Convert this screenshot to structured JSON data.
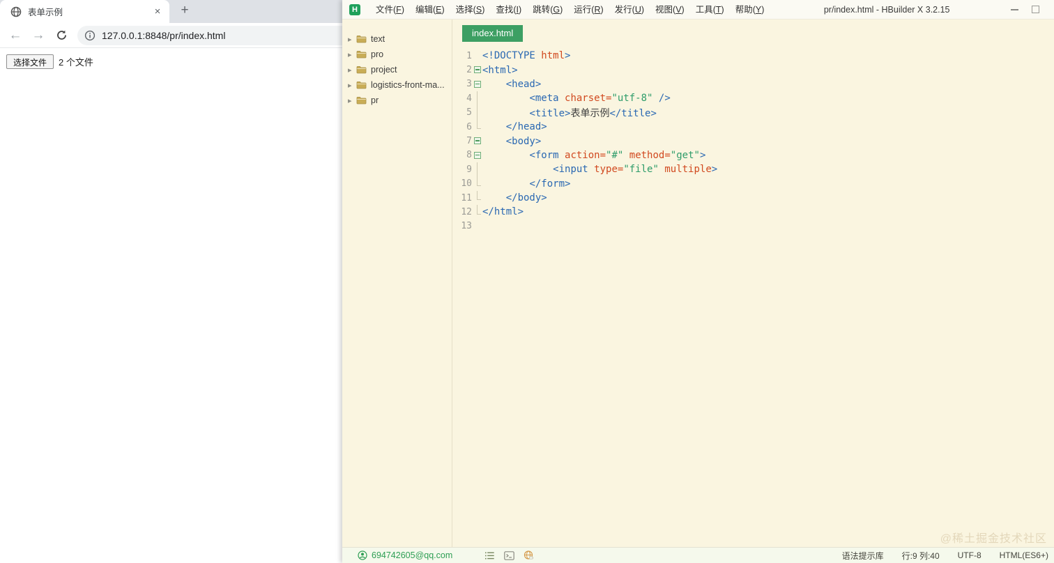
{
  "browser": {
    "tab": {
      "title": "表单示例",
      "close": "×"
    },
    "new_tab": "+",
    "toolbar": {
      "back": "←",
      "forward": "→",
      "url": "127.0.0.1:8848/pr/index.html"
    },
    "page": {
      "file_button": "选择文件",
      "file_status": "2 个文件"
    }
  },
  "hbuilder": {
    "titlebar": {
      "title": "pr/index.html - HBuilder X 3.2.15",
      "logo": "H"
    },
    "menu": {
      "items": [
        "文件(F)",
        "编辑(E)",
        "选择(S)",
        "查找(I)",
        "跳转(G)",
        "运行(R)",
        "发行(U)",
        "视图(V)",
        "工具(T)",
        "帮助(Y)"
      ]
    },
    "sidebar": {
      "folders": [
        "text",
        "pro",
        "project",
        "logistics-front-ma...",
        "pr"
      ]
    },
    "editor": {
      "tab": "index.html",
      "watermark": "@稀土掘金技术社区",
      "lines": [
        {
          "num": 1,
          "fold": "none",
          "segs": [
            [
              "tag",
              "<!DOCTYPE "
            ],
            [
              "attr",
              "html"
            ],
            [
              "tag",
              ">"
            ]
          ]
        },
        {
          "num": 2,
          "fold": "minus",
          "segs": [
            [
              "tag",
              "<html>"
            ]
          ]
        },
        {
          "num": 3,
          "fold": "minus",
          "segs": [
            [
              "plain",
              "    "
            ],
            [
              "tag",
              "<head>"
            ]
          ]
        },
        {
          "num": 4,
          "fold": "line",
          "segs": [
            [
              "plain",
              "        "
            ],
            [
              "tag",
              "<meta "
            ],
            [
              "attr",
              "charset="
            ],
            [
              "val",
              "\"utf-8\""
            ],
            [
              "tag",
              " />"
            ]
          ]
        },
        {
          "num": 5,
          "fold": "line",
          "segs": [
            [
              "plain",
              "        "
            ],
            [
              "tag",
              "<title>"
            ],
            [
              "txt",
              "表单示例"
            ],
            [
              "tag",
              "</title>"
            ]
          ]
        },
        {
          "num": 6,
          "fold": "hook",
          "segs": [
            [
              "plain",
              "    "
            ],
            [
              "tag",
              "</head>"
            ]
          ]
        },
        {
          "num": 7,
          "fold": "minus",
          "segs": [
            [
              "plain",
              "    "
            ],
            [
              "tag",
              "<body>"
            ]
          ]
        },
        {
          "num": 8,
          "fold": "minus",
          "segs": [
            [
              "plain",
              "        "
            ],
            [
              "tag",
              "<form "
            ],
            [
              "attr",
              "action="
            ],
            [
              "val",
              "\"#\""
            ],
            [
              "plain",
              " "
            ],
            [
              "attr",
              "method="
            ],
            [
              "val",
              "\"get\""
            ],
            [
              "tag",
              ">"
            ]
          ]
        },
        {
          "num": 9,
          "fold": "line",
          "segs": [
            [
              "plain",
              "            "
            ],
            [
              "tag",
              "<input "
            ],
            [
              "attr",
              "type="
            ],
            [
              "val",
              "\"file\""
            ],
            [
              "plain",
              " "
            ],
            [
              "attr",
              "multiple"
            ],
            [
              "tag",
              ">"
            ]
          ]
        },
        {
          "num": 10,
          "fold": "hook",
          "segs": [
            [
              "plain",
              "        "
            ],
            [
              "tag",
              "</form>"
            ]
          ]
        },
        {
          "num": 11,
          "fold": "hook",
          "segs": [
            [
              "plain",
              "    "
            ],
            [
              "tag",
              "</body>"
            ]
          ]
        },
        {
          "num": 12,
          "fold": "hook",
          "segs": [
            [
              "tag",
              "</html>"
            ]
          ]
        },
        {
          "num": 13,
          "fold": "none",
          "segs": []
        }
      ]
    },
    "statusbar": {
      "account": "694742605@qq.com",
      "right": [
        "语法提示库",
        "行:9 列:40",
        "UTF-8",
        "HTML(ES6+)"
      ]
    }
  },
  "colors": {
    "accent_green": "#3d9f63",
    "logo_green": "#1fa05a",
    "editor_bg": "#faf5e0",
    "tag_blue": "#2a68b2",
    "attr_red": "#d1491f",
    "value_green": "#2e9c6a",
    "browser_tabstrip": "#dee1e6",
    "urlbar_bg": "#f1f3f4"
  }
}
